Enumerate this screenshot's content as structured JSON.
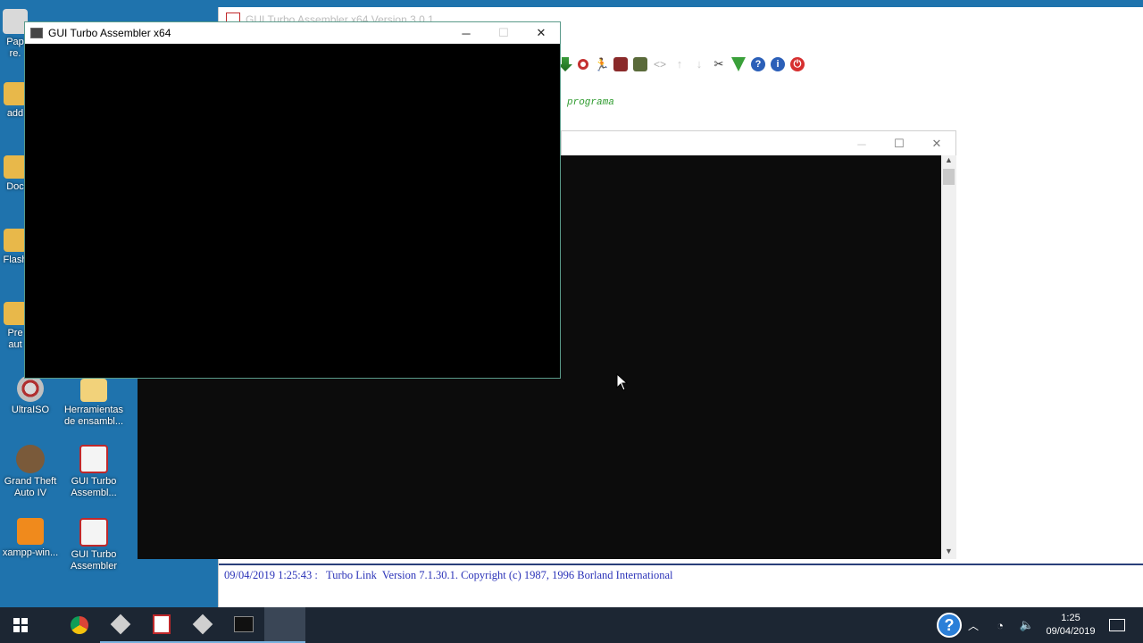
{
  "desktop": {
    "icons": [
      {
        "label": "Pap re.",
        "icon": "folder-icon"
      },
      {
        "label": "add",
        "icon": "app-icon"
      },
      {
        "label": "Doc",
        "icon": "document-icon"
      },
      {
        "label": "Flash",
        "icon": "flash-icon"
      },
      {
        "label": "Pre aut",
        "icon": "app-icon"
      },
      {
        "label": "UltraISO",
        "icon": "ultraiso-icon"
      },
      {
        "label": "Herramientas de ensambl...",
        "icon": "folder-icon"
      },
      {
        "label": "Grand Theft Auto IV",
        "icon": "gta-icon"
      },
      {
        "label": "GUI Turbo Assembl...",
        "icon": "tasm-icon"
      },
      {
        "label": "xampp-win...",
        "icon": "xampp-icon"
      },
      {
        "label": "GUI Turbo Assembler",
        "icon": "tasm-icon"
      }
    ]
  },
  "ide": {
    "title": "GUI Turbo Assembler x64 Version 3.0.1",
    "editor_line": "programa",
    "output_line": "09/04/2019 1:25:43 :   Turbo Link  Version 7.1.30.1. Copyright (c) 1987, 1996 Borland International"
  },
  "console_front": {
    "title": "GUI Turbo Assembler x64"
  },
  "window_controls": {
    "minimize": "─",
    "maximize": "☐",
    "close": "✕"
  },
  "taskbar": {
    "time": "1:25",
    "date": "09/04/2019"
  },
  "colors": {
    "desktop": "#1f73ad",
    "taskbar": "#1c2633",
    "console": "#000000",
    "output_text": "#2a32b8",
    "editor_comment": "#2e9b2e"
  }
}
